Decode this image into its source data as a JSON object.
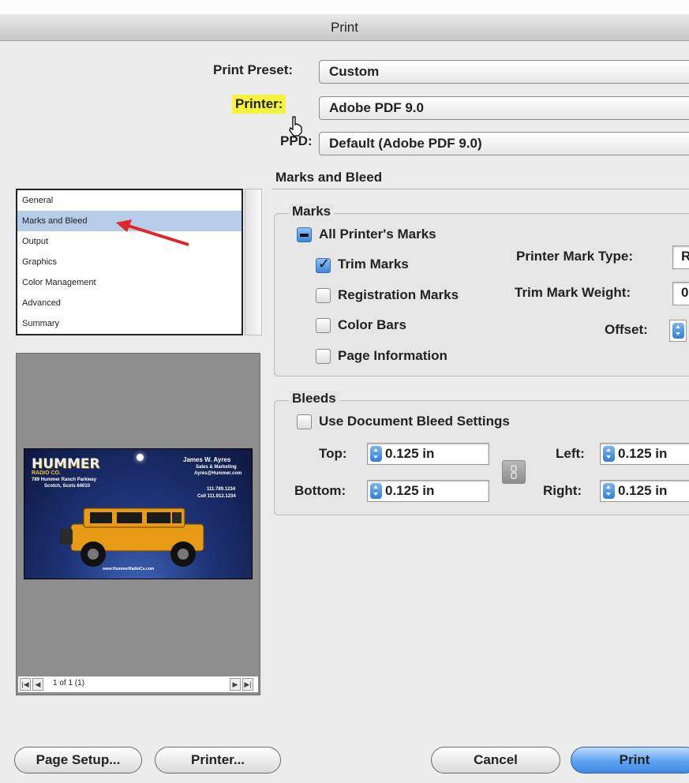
{
  "window": {
    "title": "Print"
  },
  "print_preset": {
    "label": "Print Preset:",
    "value": "Custom"
  },
  "printer": {
    "label": "Printer:",
    "value": "Adobe PDF 9.0"
  },
  "ppd": {
    "label": "PPD:",
    "value": "Default (Adobe PDF 9.0)"
  },
  "section_title": "Marks and Bleed",
  "categories": [
    {
      "label": "General"
    },
    {
      "label": "Marks and Bleed"
    },
    {
      "label": "Output"
    },
    {
      "label": "Graphics"
    },
    {
      "label": "Color Management"
    },
    {
      "label": "Advanced"
    },
    {
      "label": "Summary"
    }
  ],
  "preview": {
    "card": {
      "logo": "HUMMER",
      "logo_sub": "RADIO CO.",
      "name": "James W. Ayres",
      "title": "Sales & Marketing",
      "email": "Ayres@Hummer.com",
      "phone": "111.789.1234",
      "cell": "Cell 111.912.1234",
      "address1": "789 Hummer Ranch Parkway",
      "address2": "Scotch, Scots 64010",
      "url": "www.HummerRadioCo.com"
    },
    "page_label": "1 of 1 (1)"
  },
  "marks": {
    "group_title": "Marks",
    "all_printers_marks": "All Printer's Marks",
    "trim_marks": "Trim Marks",
    "registration_marks": "Registration Marks",
    "color_bars": "Color Bars",
    "page_information": "Page Information",
    "printer_mark_type_label": "Printer Mark Type:",
    "printer_mark_type_value": "R",
    "trim_mark_weight_label": "Trim Mark Weight:",
    "trim_mark_weight_value": "0",
    "offset_label": "Offset:"
  },
  "bleeds": {
    "group_title": "Bleeds",
    "use_document": "Use Document Bleed Settings",
    "top_label": "Top:",
    "top_value": "0.125 in",
    "bottom_label": "Bottom:",
    "bottom_value": "0.125 in",
    "left_label": "Left:",
    "left_value": "0.125 in",
    "right_label": "Right:",
    "right_value": "0.125 in"
  },
  "buttons": {
    "page_setup": "Page Setup...",
    "printer": "Printer...",
    "cancel": "Cancel",
    "print": "Print"
  },
  "colors": {
    "highlight": "#f6f33c",
    "selection": "#b5cde8",
    "accent": "#3f89e3",
    "annotation_arrow": "#e0262b"
  }
}
